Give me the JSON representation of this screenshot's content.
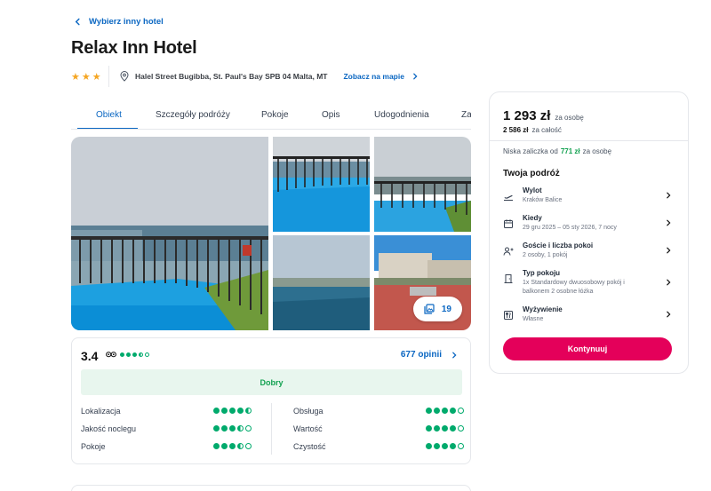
{
  "nav": {
    "back_label": "Wybierz inny hotel"
  },
  "hotel": {
    "name": "Relax Inn Hotel",
    "stars": 3,
    "address": "Halel Street Bugibba, St. Paul's Bay SPB 04 Malta, MT",
    "map_link": "Zobacz na mapie"
  },
  "tabs": [
    "Obiekt",
    "Szczegóły podróży",
    "Pokoje",
    "Opis",
    "Udogodnienia",
    "Za"
  ],
  "gallery": {
    "photo_count": "19"
  },
  "rating": {
    "score": "3.4",
    "tripadvisor_bubbles": 3.5,
    "reviews_label": "677 opinii",
    "verdict": "Dobry",
    "criteria_left": [
      {
        "name": "Lokalizacja",
        "value": 4.5
      },
      {
        "name": "Jakość noclegu",
        "value": 3.5
      },
      {
        "name": "Pokoje",
        "value": 3.5
      }
    ],
    "criteria_right": [
      {
        "name": "Obsługa",
        "value": 4
      },
      {
        "name": "Wartość",
        "value": 4
      },
      {
        "name": "Czystość",
        "value": 4
      }
    ]
  },
  "booking": {
    "price": "1 293 zł",
    "price_suffix": "za osobę",
    "total": "2 586 zł",
    "total_suffix": "za całość",
    "deposit_prefix": "Niska zaliczka od",
    "deposit_amount": "771 zł",
    "deposit_suffix": "za osobę",
    "trip_heading": "Twoja podróż",
    "rows": [
      {
        "label": "Wylot",
        "value": "Kraków Balice",
        "icon": "plane-departure-icon"
      },
      {
        "label": "Kiedy",
        "value": "29 gru 2025 – 05 sty 2026, 7 nocy",
        "icon": "calendar-icon"
      },
      {
        "label": "Goście i liczba pokoi",
        "value": "2 osoby, 1 pokój",
        "icon": "guests-icon"
      },
      {
        "label": "Typ pokoju",
        "value": "1x Standardowy dwuosobowy pokój i balkonem 2 osobne łóżka",
        "icon": "door-icon"
      },
      {
        "label": "Wyżywienie",
        "value": "Własne",
        "icon": "cutlery-icon"
      }
    ],
    "cta_label": "Kontynuuj"
  },
  "colors": {
    "accent_blue": "#0b67c2",
    "cta_pink": "#e4005a",
    "rating_green": "#00aa6c",
    "star": "#f5a623"
  }
}
